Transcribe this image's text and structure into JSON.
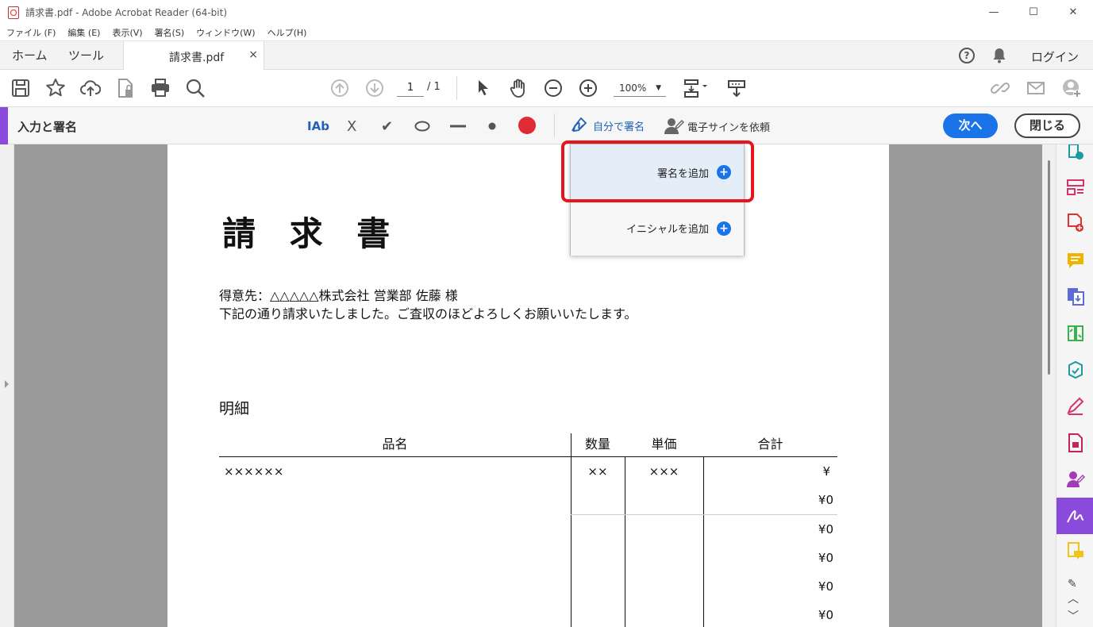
{
  "window": {
    "title": "請求書.pdf - Adobe Acrobat Reader (64-bit)",
    "minimize": "—",
    "maximize": "☐",
    "close": "✕"
  },
  "menu": [
    "ファイル (F)",
    "編集 (E)",
    "表示(V)",
    "署名(S)",
    "ウィンドウ(W)",
    "ヘルプ(H)"
  ],
  "tabs": {
    "home": "ホーム",
    "tools": "ツール",
    "doc": "請求書.pdf",
    "doc_close": "×",
    "help": "?",
    "login": "ログイン"
  },
  "toolbar": {
    "page_current": "1",
    "page_total": "/ 1",
    "zoom": "100%",
    "zoom_arrow": "▼"
  },
  "signbar": {
    "title": "入力と署名",
    "text_tool": "IAb",
    "cross_tool": "X",
    "check_tool": "✔",
    "self_sign": "自分で署名",
    "request_sign": "電子サインを依頼",
    "next": "次へ",
    "close": "閉じる"
  },
  "dropdown": {
    "add_signature": "署名を追加",
    "add_initials": "イニシャルを追加",
    "plus": "+"
  },
  "document": {
    "title": "請 求 書",
    "client": "得意先：△△△△△株式会社 営業部 佐藤 様",
    "message": "下記の通り請求いたしました。ご査収のほどよろしくお願いいたします。",
    "detail_heading": "明細",
    "table": {
      "headers": [
        "品名",
        "数量",
        "単価",
        "合計"
      ],
      "row1": {
        "item": "××××××",
        "qty": "××",
        "price": "×××",
        "total": "¥"
      },
      "totals": [
        "¥0",
        "¥0",
        "¥0",
        "¥0",
        "¥0"
      ]
    }
  },
  "colors": {
    "accent_purple": "#8a4bdc",
    "primary_blue": "#1a73e8",
    "highlight_red": "#e8141c",
    "record_red": "#e02a35"
  }
}
